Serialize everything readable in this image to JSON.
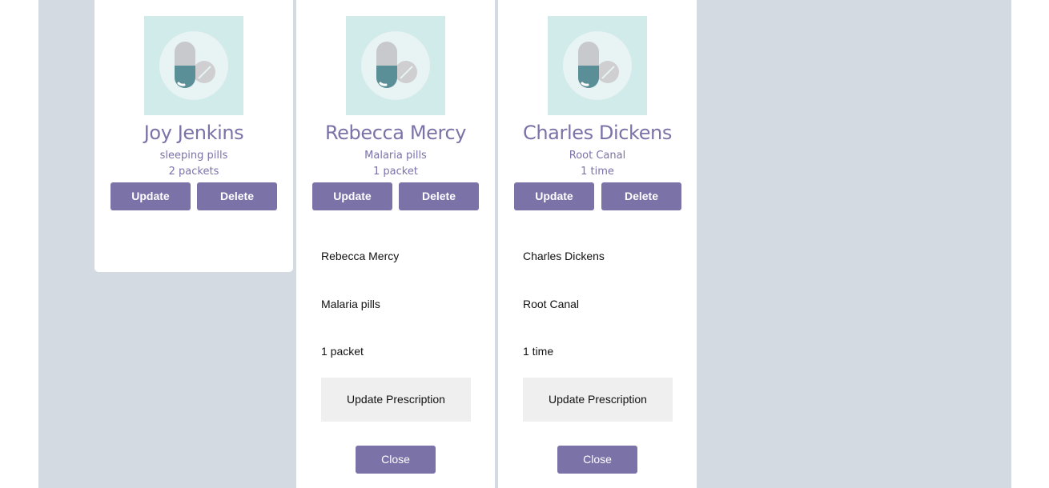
{
  "cards": [
    {
      "name": "Joy Jenkins",
      "medication": "sleeping pills",
      "quantity": "2 packets",
      "update_label": "Update",
      "delete_label": "Delete",
      "icon": "pills-icon"
    },
    {
      "name": "Rebecca Mercy",
      "medication": "Malaria pills",
      "quantity": "1 packet",
      "update_label": "Update",
      "delete_label": "Delete",
      "icon": "pills-icon",
      "form": {
        "name_value": "Rebecca Mercy",
        "medication_value": "Malaria pills",
        "quantity_value": "1 packet",
        "update_prescription_label": "Update Prescription",
        "close_label": "Close"
      }
    },
    {
      "name": "Charles Dickens",
      "medication": "Root Canal",
      "quantity": "1 time",
      "update_label": "Update",
      "delete_label": "Delete",
      "icon": "pills-icon",
      "form": {
        "name_value": "Charles Dickens",
        "medication_value": "Root Canal",
        "quantity_value": "1 time",
        "update_prescription_label": "Update Prescription",
        "close_label": "Close"
      }
    }
  ],
  "colors": {
    "accent": "#7b72a8",
    "page_background": "#d3dae2",
    "avatar_background": "#d1eaea",
    "capsule_teal": "#5a8f98"
  }
}
